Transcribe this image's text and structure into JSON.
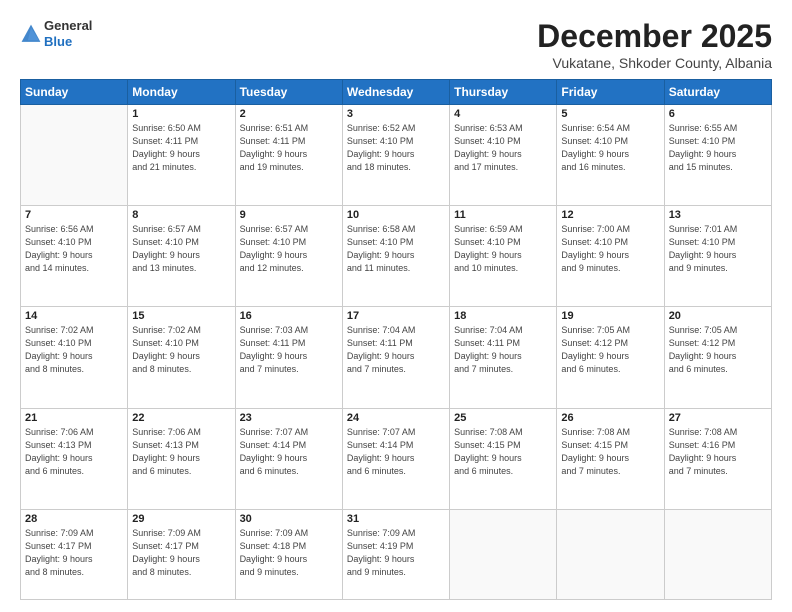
{
  "header": {
    "logo_general": "General",
    "logo_blue": "Blue",
    "title": "December 2025",
    "location": "Vukatane, Shkoder County, Albania"
  },
  "calendar": {
    "days_of_week": [
      "Sunday",
      "Monday",
      "Tuesday",
      "Wednesday",
      "Thursday",
      "Friday",
      "Saturday"
    ],
    "weeks": [
      [
        {
          "day": "",
          "info": ""
        },
        {
          "day": "1",
          "info": "Sunrise: 6:50 AM\nSunset: 4:11 PM\nDaylight: 9 hours\nand 21 minutes."
        },
        {
          "day": "2",
          "info": "Sunrise: 6:51 AM\nSunset: 4:11 PM\nDaylight: 9 hours\nand 19 minutes."
        },
        {
          "day": "3",
          "info": "Sunrise: 6:52 AM\nSunset: 4:10 PM\nDaylight: 9 hours\nand 18 minutes."
        },
        {
          "day": "4",
          "info": "Sunrise: 6:53 AM\nSunset: 4:10 PM\nDaylight: 9 hours\nand 17 minutes."
        },
        {
          "day": "5",
          "info": "Sunrise: 6:54 AM\nSunset: 4:10 PM\nDaylight: 9 hours\nand 16 minutes."
        },
        {
          "day": "6",
          "info": "Sunrise: 6:55 AM\nSunset: 4:10 PM\nDaylight: 9 hours\nand 15 minutes."
        }
      ],
      [
        {
          "day": "7",
          "info": "Sunrise: 6:56 AM\nSunset: 4:10 PM\nDaylight: 9 hours\nand 14 minutes."
        },
        {
          "day": "8",
          "info": "Sunrise: 6:57 AM\nSunset: 4:10 PM\nDaylight: 9 hours\nand 13 minutes."
        },
        {
          "day": "9",
          "info": "Sunrise: 6:57 AM\nSunset: 4:10 PM\nDaylight: 9 hours\nand 12 minutes."
        },
        {
          "day": "10",
          "info": "Sunrise: 6:58 AM\nSunset: 4:10 PM\nDaylight: 9 hours\nand 11 minutes."
        },
        {
          "day": "11",
          "info": "Sunrise: 6:59 AM\nSunset: 4:10 PM\nDaylight: 9 hours\nand 10 minutes."
        },
        {
          "day": "12",
          "info": "Sunrise: 7:00 AM\nSunset: 4:10 PM\nDaylight: 9 hours\nand 9 minutes."
        },
        {
          "day": "13",
          "info": "Sunrise: 7:01 AM\nSunset: 4:10 PM\nDaylight: 9 hours\nand 9 minutes."
        }
      ],
      [
        {
          "day": "14",
          "info": "Sunrise: 7:02 AM\nSunset: 4:10 PM\nDaylight: 9 hours\nand 8 minutes."
        },
        {
          "day": "15",
          "info": "Sunrise: 7:02 AM\nSunset: 4:10 PM\nDaylight: 9 hours\nand 8 minutes."
        },
        {
          "day": "16",
          "info": "Sunrise: 7:03 AM\nSunset: 4:11 PM\nDaylight: 9 hours\nand 7 minutes."
        },
        {
          "day": "17",
          "info": "Sunrise: 7:04 AM\nSunset: 4:11 PM\nDaylight: 9 hours\nand 7 minutes."
        },
        {
          "day": "18",
          "info": "Sunrise: 7:04 AM\nSunset: 4:11 PM\nDaylight: 9 hours\nand 7 minutes."
        },
        {
          "day": "19",
          "info": "Sunrise: 7:05 AM\nSunset: 4:12 PM\nDaylight: 9 hours\nand 6 minutes."
        },
        {
          "day": "20",
          "info": "Sunrise: 7:05 AM\nSunset: 4:12 PM\nDaylight: 9 hours\nand 6 minutes."
        }
      ],
      [
        {
          "day": "21",
          "info": "Sunrise: 7:06 AM\nSunset: 4:13 PM\nDaylight: 9 hours\nand 6 minutes."
        },
        {
          "day": "22",
          "info": "Sunrise: 7:06 AM\nSunset: 4:13 PM\nDaylight: 9 hours\nand 6 minutes."
        },
        {
          "day": "23",
          "info": "Sunrise: 7:07 AM\nSunset: 4:14 PM\nDaylight: 9 hours\nand 6 minutes."
        },
        {
          "day": "24",
          "info": "Sunrise: 7:07 AM\nSunset: 4:14 PM\nDaylight: 9 hours\nand 6 minutes."
        },
        {
          "day": "25",
          "info": "Sunrise: 7:08 AM\nSunset: 4:15 PM\nDaylight: 9 hours\nand 6 minutes."
        },
        {
          "day": "26",
          "info": "Sunrise: 7:08 AM\nSunset: 4:15 PM\nDaylight: 9 hours\nand 7 minutes."
        },
        {
          "day": "27",
          "info": "Sunrise: 7:08 AM\nSunset: 4:16 PM\nDaylight: 9 hours\nand 7 minutes."
        }
      ],
      [
        {
          "day": "28",
          "info": "Sunrise: 7:09 AM\nSunset: 4:17 PM\nDaylight: 9 hours\nand 8 minutes."
        },
        {
          "day": "29",
          "info": "Sunrise: 7:09 AM\nSunset: 4:17 PM\nDaylight: 9 hours\nand 8 minutes."
        },
        {
          "day": "30",
          "info": "Sunrise: 7:09 AM\nSunset: 4:18 PM\nDaylight: 9 hours\nand 9 minutes."
        },
        {
          "day": "31",
          "info": "Sunrise: 7:09 AM\nSunset: 4:19 PM\nDaylight: 9 hours\nand 9 minutes."
        },
        {
          "day": "",
          "info": ""
        },
        {
          "day": "",
          "info": ""
        },
        {
          "day": "",
          "info": ""
        }
      ]
    ]
  }
}
